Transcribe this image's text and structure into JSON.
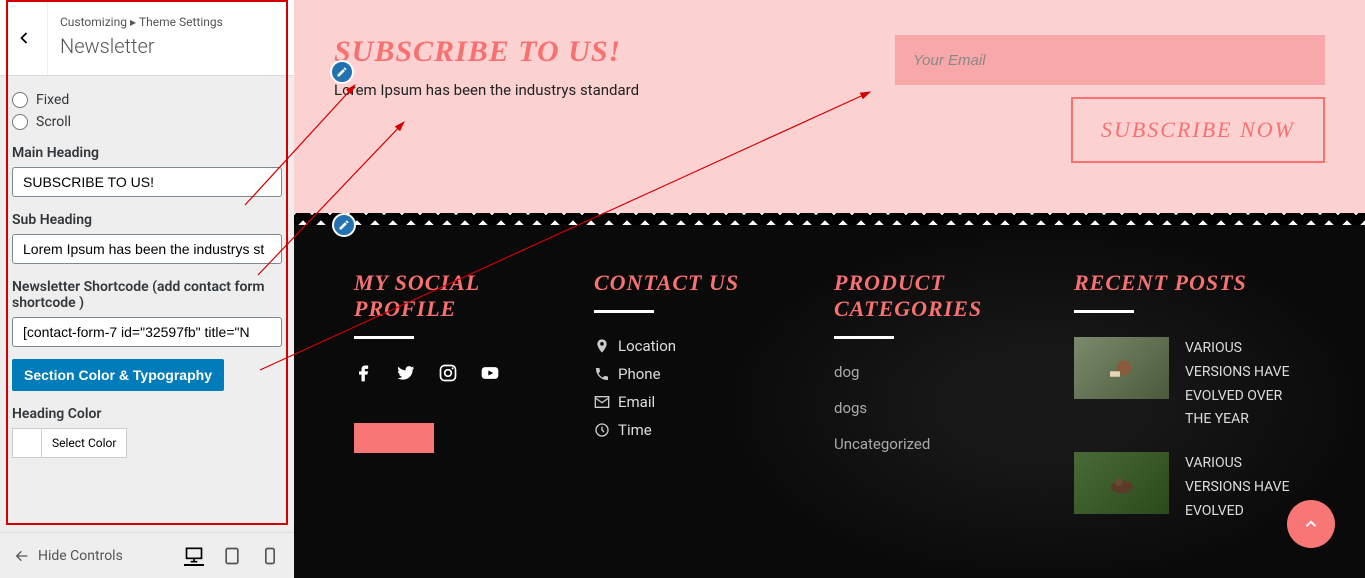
{
  "breadcrumb": {
    "customizing": "Customizing",
    "theme_settings": "Theme Settings"
  },
  "page_title": "Newsletter",
  "radios": {
    "fixed": "Fixed",
    "scroll": "Scroll"
  },
  "fields": {
    "main_heading_label": "Main Heading",
    "main_heading_value": "SUBSCRIBE TO US!",
    "sub_heading_label": "Sub Heading",
    "sub_heading_value": "Lorem Ipsum has been the industrys st",
    "shortcode_label": "Newsletter Shortcode (add contact form shortcode )",
    "shortcode_value": "[contact-form-7 id=\"32597fb\" title=\"N",
    "section_btn": "Section Color & Typography",
    "heading_color_label": "Heading Color",
    "select_color": "Select Color"
  },
  "footer_bar": {
    "hide_controls": "Hide Controls"
  },
  "preview": {
    "subscribe_heading": "SUBSCRIBE TO US!",
    "sub_heading": "Lorem Ipsum has been the industrys standard",
    "email_placeholder": "Your Email",
    "subscribe_btn": "SUBSCRIBE NOW"
  },
  "footer": {
    "social_heading": "MY SOCIAL PROFILE",
    "contact_heading": "CONTACT US",
    "contact": {
      "location": "Location",
      "phone": "Phone",
      "email": "Email",
      "time": "Time"
    },
    "categories_heading": "PRODUCT CATEGORIES",
    "categories": [
      "dog",
      "dogs",
      "Uncategorized"
    ],
    "posts_heading": "RECENT POSTS",
    "posts": [
      "VARIOUS VERSIONS HAVE EVOLVED OVER THE YEAR",
      "VARIOUS VERSIONS HAVE EVOLVED"
    ]
  }
}
